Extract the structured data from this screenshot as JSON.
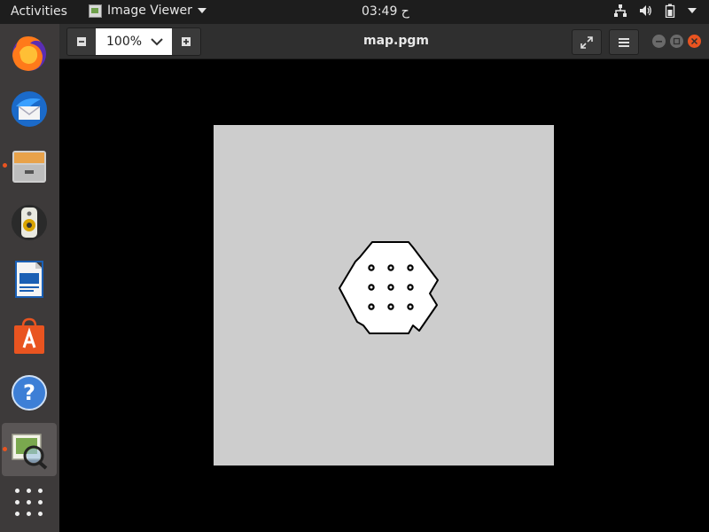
{
  "topbar": {
    "activities": "Activities",
    "app_name": "Image Viewer",
    "clock": "03:49 ح"
  },
  "dock": {
    "items": [
      {
        "name": "firefox",
        "icon": "firefox-icon",
        "running": false
      },
      {
        "name": "thunderbird",
        "icon": "thunderbird-icon",
        "running": false
      },
      {
        "name": "files",
        "icon": "files-icon",
        "running": true
      },
      {
        "name": "rhythmbox",
        "icon": "rhythmbox-icon",
        "running": false
      },
      {
        "name": "libreoffice-writer",
        "icon": "writer-icon",
        "running": false
      },
      {
        "name": "software",
        "icon": "software-icon",
        "running": false
      },
      {
        "name": "help",
        "icon": "help-icon",
        "running": false
      },
      {
        "name": "image-viewer",
        "icon": "image-viewer-icon",
        "running": true,
        "active": true
      }
    ]
  },
  "toolbar": {
    "zoom_value": "100%"
  },
  "window": {
    "title": "map.pgm"
  },
  "colors": {
    "accent": "#e95420",
    "map_background": "#cdcdcd",
    "map_free": "#ffffff",
    "map_obstacle": "#000000"
  }
}
